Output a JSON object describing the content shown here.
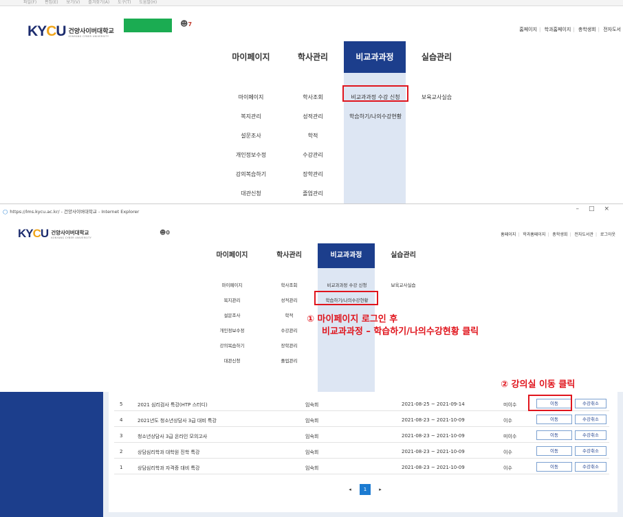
{
  "browser_menu": [
    "파일(F)",
    "편집(E)",
    "보기(V)",
    "즐겨찾기(A)",
    "도구(T)",
    "도움말(H)"
  ],
  "brand": {
    "mark_k": "K",
    "mark_y": "Y",
    "mark_c": "C",
    "mark_u": "U",
    "name_ko": "건양사이버대학교",
    "name_en": "KONYANG CYBER UNIVERSITY"
  },
  "top_user_count": "7",
  "top_links": [
    "홈페이지",
    "학과홈페이지",
    "총학생회",
    "전자도서"
  ],
  "nav": [
    {
      "label": "마이페이지",
      "active": false
    },
    {
      "label": "학사관리",
      "active": false
    },
    {
      "label": "비교과과정",
      "active": true
    },
    {
      "label": "실습관리",
      "active": false
    }
  ],
  "submenu": {
    "mypage": [
      "마이페이지",
      "복지관리",
      "설문조사",
      "개인정보수정",
      "강의복습하기",
      "대관신청"
    ],
    "academic": [
      "학사조회",
      "성적관리",
      "학적",
      "수강관리",
      "장학관리",
      "졸업관리"
    ],
    "nonsubject": [
      "비교과과정 수강 신청",
      "학습하기/나의수강현황"
    ],
    "practice": [
      "보육교사실습"
    ]
  },
  "ie": {
    "url_title": "https://lms.kycu.ac.kr/ - 건양사이버대학교 - Internet Explorer",
    "window_controls": [
      "–",
      "□",
      "×"
    ],
    "user_count": "0",
    "top_links": [
      "홈페이지",
      "학과홈페이지",
      "총학생회",
      "전자도서관",
      "로그아웃"
    ]
  },
  "annotation_1": {
    "line1": "① 마이페이지 로그인 후",
    "line2": "비교과과정 – 학습하기/나의수강현황 클릭"
  },
  "annotation_2": "② 강의실 이동 클릭",
  "course_rows": [
    {
      "no": "5",
      "title": "2021 심리검사 특강(HTP 스터디)",
      "instructor": "임숙희",
      "period": "2021-08-25 ~ 2021-09-14",
      "status": "미이수",
      "move": "이동",
      "cancel": "수강취소"
    },
    {
      "no": "4",
      "title": "2021년도 청소년상담사 3급 대비 특강",
      "instructor": "임숙희",
      "period": "2021-08-23 ~ 2021-10-09",
      "status": "이수",
      "move": "이동",
      "cancel": "수강취소"
    },
    {
      "no": "3",
      "title": "청소년상담사 3급 온라인 모의고사",
      "instructor": "임숙희",
      "period": "2021-08-23 ~ 2021-10-09",
      "status": "미이수",
      "move": "이동",
      "cancel": "수강취소"
    },
    {
      "no": "2",
      "title": "상담심리학과 대학원 진학 특강",
      "instructor": "임숙희",
      "period": "2021-08-23 ~ 2021-10-09",
      "status": "이수",
      "move": "이동",
      "cancel": "수강취소"
    },
    {
      "no": "1",
      "title": "상담심리학과 자격증 대비 특강",
      "instructor": "임숙희",
      "period": "2021-08-23 ~ 2021-10-09",
      "status": "이수",
      "move": "이동",
      "cancel": "수강취소"
    }
  ],
  "pagination": {
    "prev": "◂",
    "current": "1",
    "next": "▸"
  }
}
